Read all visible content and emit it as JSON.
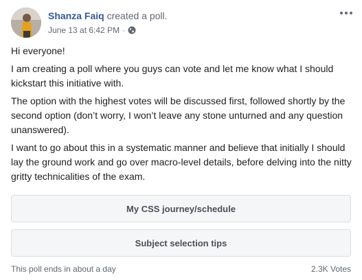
{
  "post": {
    "author_name": "Shanza Faiq",
    "action_text": "created a poll.",
    "timestamp": "June 13 at 6:42 PM",
    "meta_separator": "·",
    "privacy_icon": "globe-icon",
    "more_icon": "more-options-icon",
    "paragraphs": [
      "Hi everyone!",
      "I am creating a poll where you guys can vote and let me know what I should kickstart this initiative with.",
      "The option with the highest votes will be discussed first, followed shortly by the second option (don’t worry, I won’t leave any stone unturned and any question unanswered).",
      "I want to go about this in a systematic manner and believe that initially I should lay the ground work and go over macro-level details, before delving into the nitty gritty technicalities of the exam."
    ]
  },
  "poll": {
    "options": [
      {
        "label": "My CSS journey/schedule"
      },
      {
        "label": "Subject selection tips"
      }
    ],
    "ends_text": "This poll ends in about a day",
    "votes_text": "2.3K Votes"
  },
  "colors": {
    "link": "#385898",
    "secondary_text": "#616770",
    "option_bg": "#f5f6f7",
    "option_border": "#dadde1"
  }
}
